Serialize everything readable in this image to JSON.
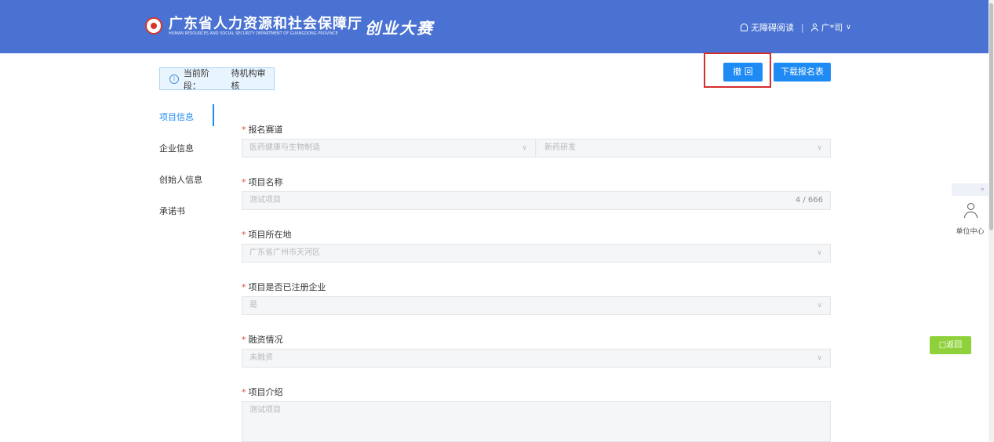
{
  "header": {
    "org_name": "广东省人力资源和社会保障厅",
    "org_name_en": "HUMAN RESOURCES AND SOCIAL SECURITY DEPARTMENT OF GUANGDONG PROVINCE",
    "brand": "创业大赛",
    "accessibility_label": "无障碍阅读",
    "separator": "|",
    "user_label": "广*司",
    "user_caret": "∨"
  },
  "stage": {
    "label": "当前阶段：",
    "value": "待机构审核",
    "icon": "ⓘ"
  },
  "actions": {
    "withdraw": "撤 回",
    "download": "下载报名表"
  },
  "menu": {
    "items": [
      "项目信息",
      "企业信息",
      "创始人信息",
      "承诺书"
    ]
  },
  "form": {
    "required_mark": "*",
    "track_label": "报名赛道",
    "track_value1": "医药健康与生物制造",
    "track_value2": "新药研发",
    "name_label": "项目名称",
    "name_value": "测试项目",
    "name_count": "4 / 666",
    "location_label": "项目所在地",
    "location_value": "广东省广州市天河区",
    "registered_label": "项目是否已注册企业",
    "registered_value": "是",
    "financing_label": "融资情况",
    "financing_value": "未融资",
    "intro_label": "项目介绍",
    "intro_value": "测试项目",
    "chevron": "∨"
  },
  "floating": {
    "toggle": "»",
    "center_label": "单位中心",
    "return": "□返回"
  }
}
